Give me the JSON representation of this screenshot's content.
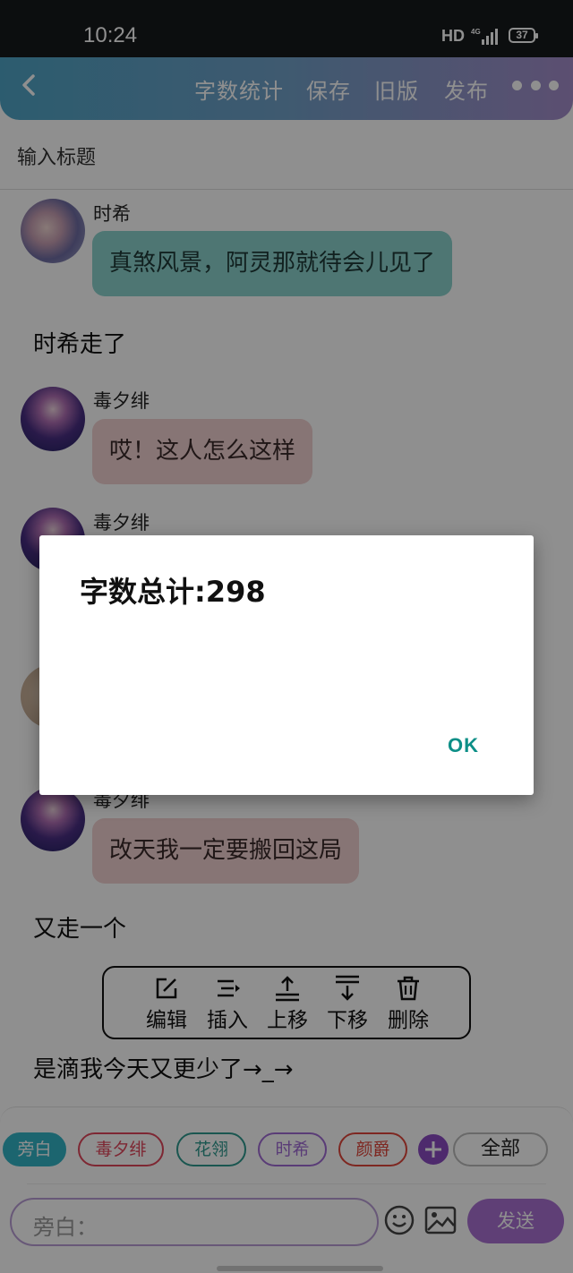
{
  "status_bar": {
    "time": "10:24",
    "hd": "HD",
    "network": "4G",
    "battery": "37"
  },
  "app_bar": {
    "actions": {
      "word_count": "字数统计",
      "save": "保存",
      "old_version": "旧版",
      "publish": "发布"
    }
  },
  "title_input": {
    "placeholder": "输入标题"
  },
  "messages": [
    {
      "type": "dialog",
      "speaker": "时希",
      "text": "真煞风景，阿灵那就待会儿见了",
      "bubble_color": "#8bd3cd"
    },
    {
      "type": "narration",
      "text": "时希走了"
    },
    {
      "type": "dialog",
      "speaker": "毒夕绯",
      "text": "哎！这人怎么这样",
      "bubble_color": "#f0d1d1"
    },
    {
      "type": "dialog",
      "speaker": "毒夕绯",
      "text": "",
      "bubble_color": "#f0d1d1"
    },
    {
      "type": "dialog",
      "speaker": "毒夕绯",
      "text": "改天我一定要搬回这局",
      "bubble_color": "#f0d1d1"
    },
    {
      "type": "narration",
      "text": "又走一个"
    },
    {
      "type": "narration",
      "text": "是滴我今天又更少了→_→"
    }
  ],
  "edit_toolbar": {
    "edit": "编辑",
    "insert": "插入",
    "move_up": "上移",
    "move_down": "下移",
    "delete": "删除"
  },
  "role_chips": [
    {
      "label": "旁白",
      "color": "#33b5c7",
      "selected": true
    },
    {
      "label": "毒夕绯",
      "color": "#e0475b",
      "selected": false
    },
    {
      "label": "花翎",
      "color": "#2f9a8f",
      "selected": false
    },
    {
      "label": "时希",
      "color": "#a06cd5",
      "selected": false
    },
    {
      "label": "颜爵",
      "color": "#e0473b",
      "selected": false
    }
  ],
  "all_chip": "全部",
  "message_input": {
    "placeholder": "旁白："
  },
  "send_button": "发送",
  "modal": {
    "message": "字数总计:298",
    "ok": "OK"
  },
  "colors": {
    "accent_teal": "#0d8f87",
    "accent_purple": "#a971d3"
  }
}
